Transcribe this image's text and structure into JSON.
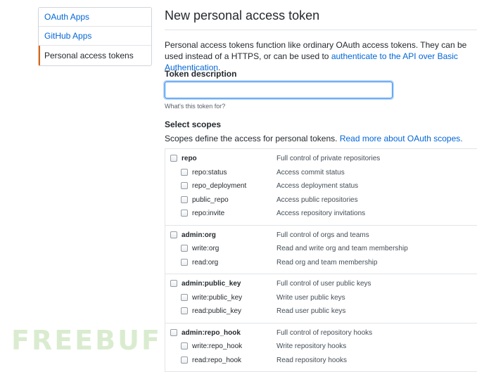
{
  "sidebar": {
    "items": [
      {
        "label": "OAuth Apps"
      },
      {
        "label": "GitHub Apps"
      },
      {
        "label": "Personal access tokens"
      }
    ]
  },
  "main": {
    "title": "New personal access token",
    "intro_text": "Personal access tokens function like ordinary OAuth access tokens. They can be used instead of a HTTPS, or can be used to ",
    "intro_link": "authenticate to the API over Basic Authentication",
    "intro_end": ".",
    "token_label": "Token description",
    "token_value": "",
    "token_note": "What's this token for?",
    "scopes_heading": "Select scopes",
    "scopes_text": "Scopes define the access for personal tokens. ",
    "scopes_link": "Read more about OAuth scopes.",
    "scope_groups": [
      {
        "parent": {
          "name": "repo",
          "desc": "Full control of private repositories"
        },
        "children": [
          {
            "name": "repo:status",
            "desc": "Access commit status"
          },
          {
            "name": "repo_deployment",
            "desc": "Access deployment status"
          },
          {
            "name": "public_repo",
            "desc": "Access public repositories"
          },
          {
            "name": "repo:invite",
            "desc": "Access repository invitations"
          }
        ]
      },
      {
        "parent": {
          "name": "admin:org",
          "desc": "Full control of orgs and teams"
        },
        "children": [
          {
            "name": "write:org",
            "desc": "Read and write org and team membership"
          },
          {
            "name": "read:org",
            "desc": "Read org and team membership"
          }
        ]
      },
      {
        "parent": {
          "name": "admin:public_key",
          "desc": "Full control of user public keys"
        },
        "children": [
          {
            "name": "write:public_key",
            "desc": "Write user public keys"
          },
          {
            "name": "read:public_key",
            "desc": "Read user public keys"
          }
        ]
      },
      {
        "parent": {
          "name": "admin:repo_hook",
          "desc": "Full control of repository hooks"
        },
        "children": [
          {
            "name": "write:repo_hook",
            "desc": "Write repository hooks"
          },
          {
            "name": "read:repo_hook",
            "desc": "Read repository hooks"
          }
        ]
      }
    ]
  },
  "watermark": "FREEBUF",
  "colors": {
    "accent": "#e36209",
    "link": "#0366d6",
    "focus": "#2188ff"
  }
}
